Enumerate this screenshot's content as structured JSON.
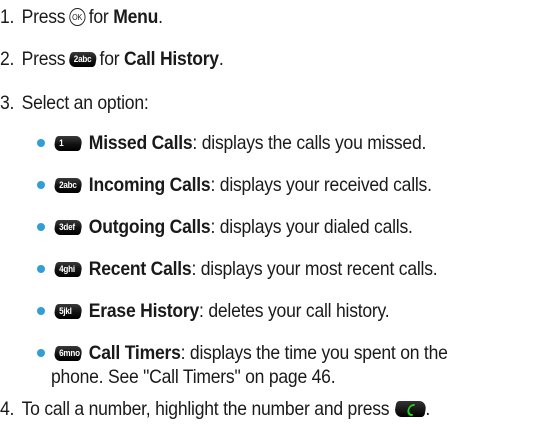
{
  "steps": [
    {
      "num": "1.",
      "pre": "Press",
      "key": "OK",
      "mid": "for",
      "bold": "Menu",
      "post": "."
    },
    {
      "num": "2.",
      "pre": "Press",
      "key": "2abc",
      "mid": "for",
      "bold": "Call History",
      "post": "."
    },
    {
      "num": "3.",
      "text": "Select an option:"
    },
    {
      "num": "4.",
      "text": "To call a number, highlight the number and press",
      "post": "."
    }
  ],
  "options": [
    {
      "key": "1",
      "label": "Missed Calls",
      "desc": ": displays the calls you missed."
    },
    {
      "key": "2abc",
      "label": "Incoming Calls",
      "desc": ": displays your received calls."
    },
    {
      "key": "3def",
      "label": "Outgoing Calls",
      "desc": ": displays your dialed calls."
    },
    {
      "key": "4ghi",
      "label": "Recent Calls",
      "desc": ": displays your most recent calls."
    },
    {
      "key": "5jkl",
      "label": "Erase History",
      "desc": ": deletes your call history."
    },
    {
      "key": "6mno",
      "label": "Call Timers",
      "desc": ": displays the time you spent on the",
      "desc2": "phone. See \"Call Timers\" on page 46."
    }
  ],
  "colors": {
    "bullet": "#2f9fd6",
    "text": "#1a1a1a"
  },
  "icons": {
    "ok": "ok-key-icon",
    "send": "send-key-icon"
  }
}
